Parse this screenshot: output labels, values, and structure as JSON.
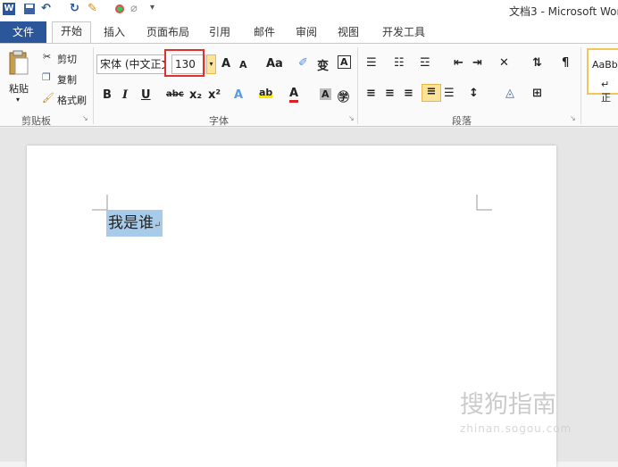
{
  "titlebar": {
    "title": "文档3 - Microsoft Wor"
  },
  "tabs": [
    "文件",
    "开始",
    "插入",
    "页面布局",
    "引用",
    "邮件",
    "审阅",
    "视图",
    "开发工具"
  ],
  "clipboard": {
    "paste": "粘贴",
    "cut": "剪切",
    "copy": "复制",
    "format_painter": "格式刷",
    "group_label": "剪贴板"
  },
  "font": {
    "font_name": "宋体 (中文正文",
    "font_size": "130",
    "group_label": "字体",
    "grow": "A",
    "shrink": "A",
    "case": "Aa",
    "bold": "B",
    "italic": "I",
    "underline": "U",
    "strike": "abc",
    "subscript": "x₂",
    "superscript": "x²"
  },
  "paragraph": {
    "group_label": "段落"
  },
  "styles": {
    "preview": "AaBb",
    "name": "↵ 正"
  },
  "document": {
    "text": "我是谁"
  },
  "watermark": {
    "main": "搜狗指南",
    "sub": "zhinan.sogou.com"
  },
  "colors": {
    "file_tab": "#2b579a",
    "selection": "#a8cbe9",
    "highlight_box": "#e0312d"
  }
}
